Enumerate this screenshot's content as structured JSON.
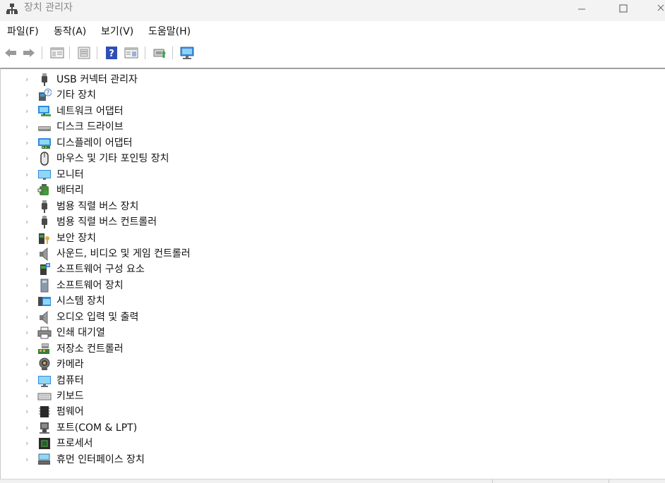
{
  "window": {
    "title": "장치 관리자",
    "controls": {
      "minimize": "—",
      "maximize": "☐",
      "close": "✕"
    }
  },
  "menu": [
    {
      "label": "파일(F)"
    },
    {
      "label": "동작(A)"
    },
    {
      "label": "보기(V)"
    },
    {
      "label": "도움말(H)"
    }
  ],
  "toolbar": {
    "buttons": [
      "back-icon",
      "forward-icon",
      "properties-icon",
      "scan-icon",
      "help-icon",
      "view-icon",
      "update-driver-icon",
      "computer-icon"
    ]
  },
  "tree": {
    "items": [
      {
        "label": "USB 커넥터 관리자",
        "icon": "usb-icon"
      },
      {
        "label": "기타 장치",
        "icon": "unknown-device-icon"
      },
      {
        "label": "네트워크 어댑터",
        "icon": "network-adapter-icon"
      },
      {
        "label": "디스크 드라이브",
        "icon": "disk-drive-icon"
      },
      {
        "label": "디스플레이 어댑터",
        "icon": "display-adapter-icon"
      },
      {
        "label": "마우스 및 기타 포인팅 장치",
        "icon": "mouse-icon"
      },
      {
        "label": "모니터",
        "icon": "monitor-icon"
      },
      {
        "label": "배터리",
        "icon": "battery-icon"
      },
      {
        "label": "범용 직렬 버스 장치",
        "icon": "usb-icon"
      },
      {
        "label": "범용 직렬 버스 컨트롤러",
        "icon": "usb-icon"
      },
      {
        "label": "보안 장치",
        "icon": "security-device-icon"
      },
      {
        "label": "사운드, 비디오 및 게임 컨트롤러",
        "icon": "speaker-icon"
      },
      {
        "label": "소프트웨어 구성 요소",
        "icon": "software-component-icon"
      },
      {
        "label": "소프트웨어 장치",
        "icon": "software-device-icon"
      },
      {
        "label": "시스템 장치",
        "icon": "system-device-icon"
      },
      {
        "label": "오디오 입력 및 출력",
        "icon": "speaker-icon"
      },
      {
        "label": "인쇄 대기열",
        "icon": "printer-icon"
      },
      {
        "label": "저장소 컨트롤러",
        "icon": "storage-controller-icon"
      },
      {
        "label": "카메라",
        "icon": "camera-icon"
      },
      {
        "label": "컴퓨터",
        "icon": "computer-icon"
      },
      {
        "label": "키보드",
        "icon": "keyboard-icon"
      },
      {
        "label": "펌웨어",
        "icon": "firmware-icon"
      },
      {
        "label": "포트(COM & LPT)",
        "icon": "port-icon"
      },
      {
        "label": "프로세서",
        "icon": "processor-icon"
      },
      {
        "label": "휴먼 인터페이스 장치",
        "icon": "hid-icon"
      }
    ]
  }
}
